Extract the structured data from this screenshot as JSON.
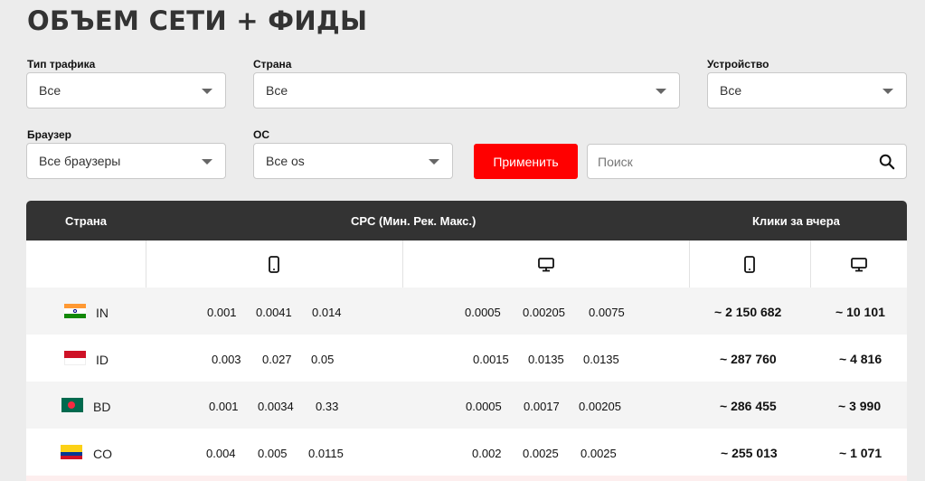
{
  "title": "ОБЪЕМ СЕТИ + ФИДЫ",
  "filters": {
    "traffic_type": {
      "label": "Тип трафика",
      "value": "Все"
    },
    "country": {
      "label": "Страна",
      "value": "Все"
    },
    "device": {
      "label": "Устройство",
      "value": "Все"
    },
    "browser": {
      "label": "Браузер",
      "value": "Все браузеры"
    },
    "os": {
      "label": "ОС",
      "value": "Все os"
    }
  },
  "apply_label": "Применить",
  "search": {
    "placeholder": "Поиск"
  },
  "table": {
    "headers": {
      "country": "Страна",
      "cpc": "CPC (Мин. Рек. Макс.)",
      "clicks": "Клики за вчера"
    },
    "subheader_icons": [
      "mobile-icon",
      "desktop-icon",
      "mobile-icon",
      "desktop-icon"
    ],
    "rows": [
      {
        "code": "IN",
        "flag": "flag-india-icon",
        "mobile_cpc": [
          "0.001",
          "0.0041",
          "0.014"
        ],
        "desktop_cpc": [
          "0.0005",
          "0.00205",
          "0.0075"
        ],
        "mobile_clicks": "~ 2 150 682",
        "desktop_clicks": "~ 10 101"
      },
      {
        "code": "ID",
        "flag": "flag-indonesia-icon",
        "mobile_cpc": [
          "0.003",
          "0.027",
          "0.05"
        ],
        "desktop_cpc": [
          "0.0015",
          "0.0135",
          "0.0135"
        ],
        "mobile_clicks": "~ 287 760",
        "desktop_clicks": "~ 4 816"
      },
      {
        "code": "BD",
        "flag": "flag-bangladesh-icon",
        "mobile_cpc": [
          "0.001",
          "0.0034",
          "0.33"
        ],
        "desktop_cpc": [
          "0.0005",
          "0.0017",
          "0.00205"
        ],
        "mobile_clicks": "~ 286 455",
        "desktop_clicks": "~ 3 990"
      },
      {
        "code": "CO",
        "flag": "flag-colombia-icon",
        "mobile_cpc": [
          "0.004",
          "0.005",
          "0.0115"
        ],
        "desktop_cpc": [
          "0.002",
          "0.0025",
          "0.0025"
        ],
        "mobile_clicks": "~ 255 013",
        "desktop_clicks": "~ 1 071"
      }
    ]
  },
  "colors": {
    "accent": "#ff0000",
    "header_bg": "#333333",
    "page_bg": "#ececec"
  }
}
